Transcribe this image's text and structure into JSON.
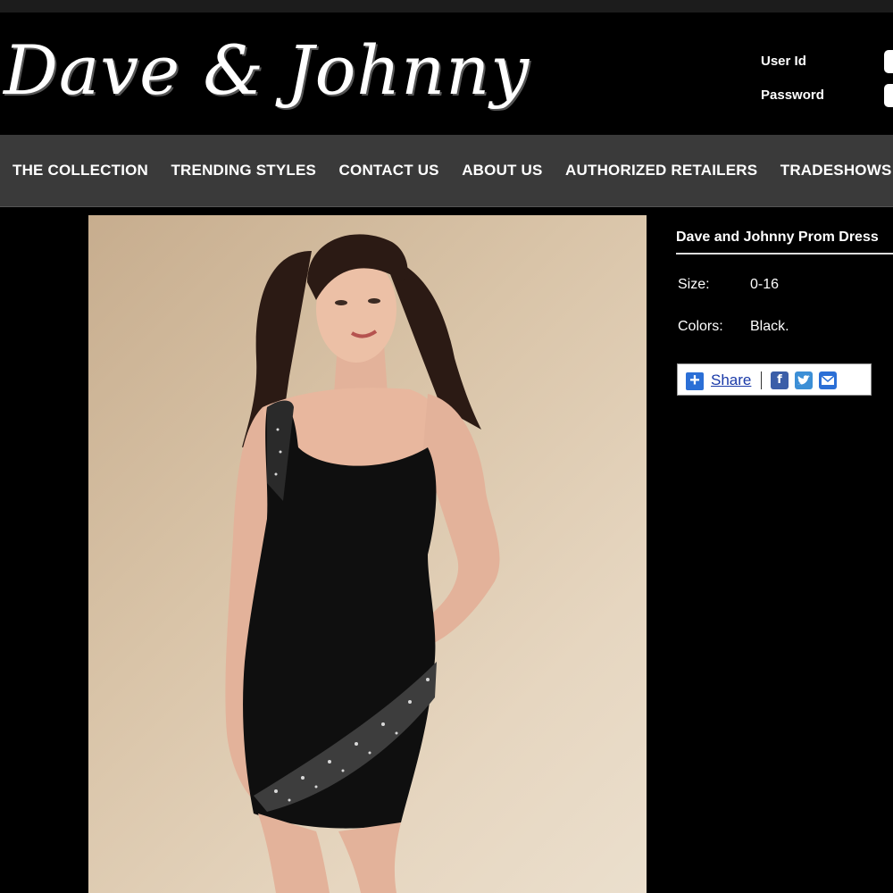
{
  "brand": {
    "logo_text": "Dave & Johnny"
  },
  "login": {
    "user_label": "User Id",
    "password_label": "Password"
  },
  "nav": {
    "items": [
      {
        "label": "THE COLLECTION"
      },
      {
        "label": "TRENDING STYLES"
      },
      {
        "label": "CONTACT US"
      },
      {
        "label": "ABOUT US"
      },
      {
        "label": "AUTHORIZED RETAILERS"
      },
      {
        "label": "TRADESHOWS"
      }
    ]
  },
  "product": {
    "title": "Dave and Johnny Prom Dress",
    "size_label": "Size:",
    "size_value": "0-16",
    "colors_label": "Colors:",
    "colors_value": "Black."
  },
  "share": {
    "label": "Share",
    "icons": [
      "facebook-icon",
      "twitter-icon",
      "email-icon"
    ]
  },
  "colors": {
    "background": "#000000",
    "nav_bar": "#3a3a3a",
    "photo_backdrop": "#d9c4a8",
    "share_link": "#1a3aa8"
  }
}
